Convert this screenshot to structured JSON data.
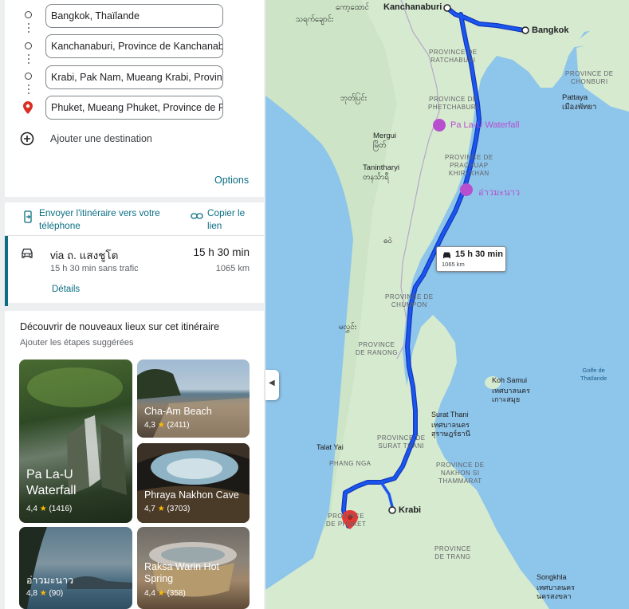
{
  "route": {
    "waypoints": [
      "Bangkok, Thaïlande",
      "Kanchanaburi, Province de Kanchanaburi",
      "Krabi, Pak Nam, Mueang Krabi, Province",
      "Phuket, Mueang Phuket, Province de Phuket"
    ],
    "add_destination": "Ajouter une destination",
    "options": "Options"
  },
  "share": {
    "send": "Envoyer l'itinéraire vers votre téléphone",
    "copy": "Copier le lien"
  },
  "result": {
    "via": "via ถ. แสงชูโต",
    "duration": "15 h 30 min",
    "traffic": "15 h 30 min sans trafic",
    "distance": "1065 km",
    "details": "Détails"
  },
  "discover": {
    "title": "Découvrir de nouveaux lieux sur cet itinéraire",
    "subtitle": "Ajouter les étapes suggérées",
    "places": [
      {
        "name": "Pa La-U Waterfall",
        "rating": "4,4",
        "count": "(1416)"
      },
      {
        "name": "Cha-Am Beach",
        "rating": "4,3",
        "count": "(2411)"
      },
      {
        "name": "Phraya Nakhon Cave",
        "rating": "4,7",
        "count": "(3703)"
      },
      {
        "name": "อ่าวมะนาว",
        "rating": "4,8",
        "count": "(90)"
      },
      {
        "name": "Raksa Warin Hot Spring",
        "rating": "4,4",
        "count": "(358)"
      }
    ]
  },
  "map": {
    "callout": {
      "duration": "15 h 30 min",
      "distance": "1065 km"
    },
    "cities": {
      "kanchanaburi": "Kanchanaburi",
      "bangkok": "Bangkok",
      "krabi": "Krabi",
      "pattaya": "Pattaya",
      "pattaya_th": "เมืองพัทยา",
      "mergui": "Mergui",
      "mergui_my": "မြိတ်",
      "tanintharyi": "Tanintharyi",
      "tanintharyi_my": "တနင်္သာရီ",
      "my1": "ကော့ထောင်",
      "my2": "သရက်ချောင်း",
      "my3": "ဘုတ်ပြင်း",
      "my4": "ဓဝဲ",
      "my5": "မလွှင်း",
      "koh_samui": "Koh Samui",
      "koh_samui_th": "เกาะสมุย",
      "koh_samui_th2": "เทศบาลนคร",
      "surat_thani": "Surat Thani",
      "surat_thani_th1": "เทศบาลนคร",
      "surat_thani_th2": "สุราษฎร์ธานี",
      "talat_yai": "Talat Yai",
      "songkhla": "Songkhla",
      "songkhla_th1": "เทศบาลนคร",
      "songkhla_th2": "นครสงขลา"
    },
    "provinces": {
      "ratchaburi": [
        "PROVINCE DE",
        "RATCHABURI"
      ],
      "chonburi": [
        "PROVINCE DE",
        "CHONBURI"
      ],
      "phetchaburi": [
        "PROVINCE DE",
        "PHETCHABURI"
      ],
      "prachuap": [
        "PROVINCE DE",
        "PRACHUAP",
        "KHIRI KHAN"
      ],
      "chumpon": [
        "PROVINCE DE",
        "CHUMPON"
      ],
      "ranong": [
        "PROVINCE",
        "DE RANONG"
      ],
      "surat": [
        "PROVINCE DE",
        "SURAT THANI"
      ],
      "phangnga": [
        "PHANG NGA"
      ],
      "nakhon": [
        "PROVINCE DE",
        "NAKHON SI",
        "THAMMARAT"
      ],
      "phuket": [
        "PROVINCE",
        "DE PHUKET"
      ],
      "trang": [
        "PROVINCE",
        "DE TRANG"
      ]
    },
    "gulf": [
      "Golfe de",
      "Thaïlande"
    ],
    "pois": {
      "palau": "Pa La-U Waterfall",
      "aomanao": "อ่าวมะนาว"
    },
    "colors": {
      "route": "#1a56f0",
      "route_outline": "#1437b8",
      "land": "#d3e9cd",
      "water": "#8ec5ea",
      "poi": "#b74fcf",
      "pin": "#e53935"
    }
  }
}
